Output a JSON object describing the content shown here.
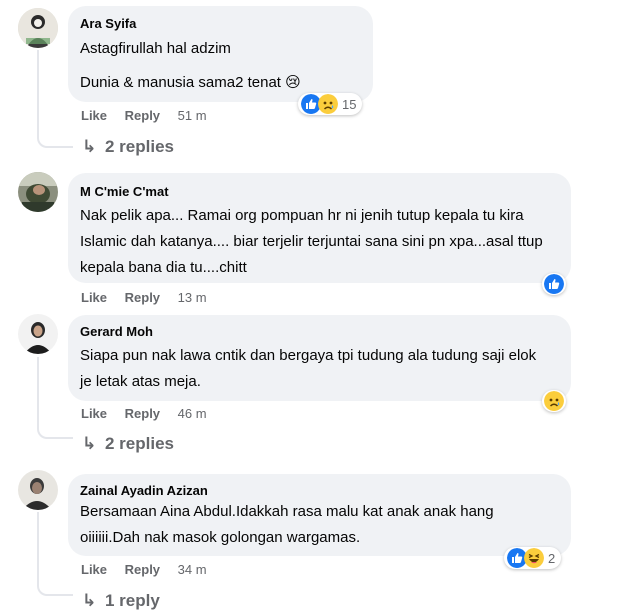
{
  "comments": [
    {
      "author": "Ara Syifa",
      "lines": [
        "Astagfirullah hal adzim",
        "Dunia & manusia sama2 tenat 😢"
      ],
      "reactions": [
        "like-icon",
        "sad-icon"
      ],
      "reaction_count": "15",
      "like_label": "Like",
      "reply_label": "Reply",
      "time": "51 m",
      "replies_label": "2 replies"
    },
    {
      "author": "M C'mie C'mat",
      "lines": [
        "Nak pelik apa... Ramai org pompuan hr ni jenih tutup kepala tu kira Islamic dah katanya.... biar terjelir terjuntai sana sini pn xpa...asal ttup kepala bana dia tu....chitt"
      ],
      "reactions": [
        "like-icon"
      ],
      "reaction_count": "",
      "like_label": "Like",
      "reply_label": "Reply",
      "time": "13 m",
      "replies_label": ""
    },
    {
      "author": "Gerard Moh",
      "lines": [
        "Siapa pun nak lawa cntik dan bergaya tpi tudung ala tudung saji elok je letak atas meja."
      ],
      "reactions": [
        "sad-icon"
      ],
      "reaction_count": "",
      "like_label": "Like",
      "reply_label": "Reply",
      "time": "46 m",
      "replies_label": "2 replies"
    },
    {
      "author": "Zainal Ayadin Azizan",
      "lines": [
        "Bersamaan Aina Abdul.Idakkah rasa malu kat anak anak hang oiiiiii.Dah nak masok golongan wargamas."
      ],
      "reactions": [
        "like-icon",
        "haha-icon"
      ],
      "reaction_count": "2",
      "like_label": "Like",
      "reply_label": "Reply",
      "time": "34 m",
      "replies_label": "1 reply"
    }
  ],
  "colors": {
    "bubble": "#f0f2f5",
    "like_blue": "#1877f2",
    "emoji_yellow": "#fbcd3c",
    "secondary_text": "#65676b"
  }
}
